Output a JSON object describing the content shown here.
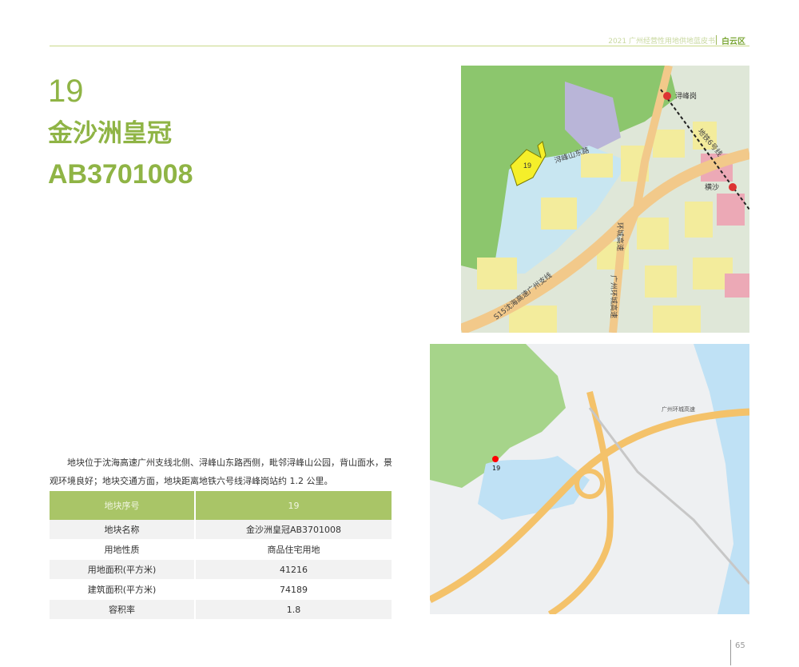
{
  "header": {
    "report_title": "2021 广州经营性用地供地蓝皮书",
    "district": "白云区"
  },
  "plot": {
    "number": "19",
    "name": "金沙洲皇冠",
    "code": "AB3701008"
  },
  "description": "地块位于沈海高速广州支线北侧、浔峰山东路西侧，毗邻浔峰山公园，背山面水，景观环境良好；地块交通方面，地块距离地铁六号线浔峰岗站约 1.2 公里。",
  "table": {
    "header": {
      "label": "地块序号",
      "value": "19"
    },
    "rows": [
      {
        "label": "地块名称",
        "value": "金沙洲皇冠AB3701008"
      },
      {
        "label": "用地性质",
        "value": "商品住宅用地"
      },
      {
        "label": "用地面积(平方米)",
        "value": "41216"
      },
      {
        "label": "建筑面积(平方米)",
        "value": "74189"
      },
      {
        "label": "容积率",
        "value": "1.8"
      }
    ]
  },
  "map_plan": {
    "plot_marker": "19",
    "labels": {
      "station_1": "浔峰岗",
      "station_2": "横沙",
      "road_1": "浔峰山东路",
      "road_2": "环城高速",
      "road_3": "S15沈海高速广州支线",
      "road_4": "广州环城高速",
      "metro": "地铁6号线"
    },
    "colors": {
      "residential": "#f3ec9c",
      "green": "#8cc66d",
      "water": "#c8e6f1",
      "commercial": "#eca9b6",
      "highway": "#f2c98a",
      "plot": "#f5ef2a"
    }
  },
  "map_street": {
    "plot_marker": "19",
    "labels": {
      "expressway": "广州环城高速"
    },
    "colors": {
      "green": "#a6d48a",
      "water": "#bfe1f5",
      "highway": "#f4c26a",
      "land": "#eef0f2",
      "marker": "#ff0000"
    }
  },
  "page_number": "65"
}
